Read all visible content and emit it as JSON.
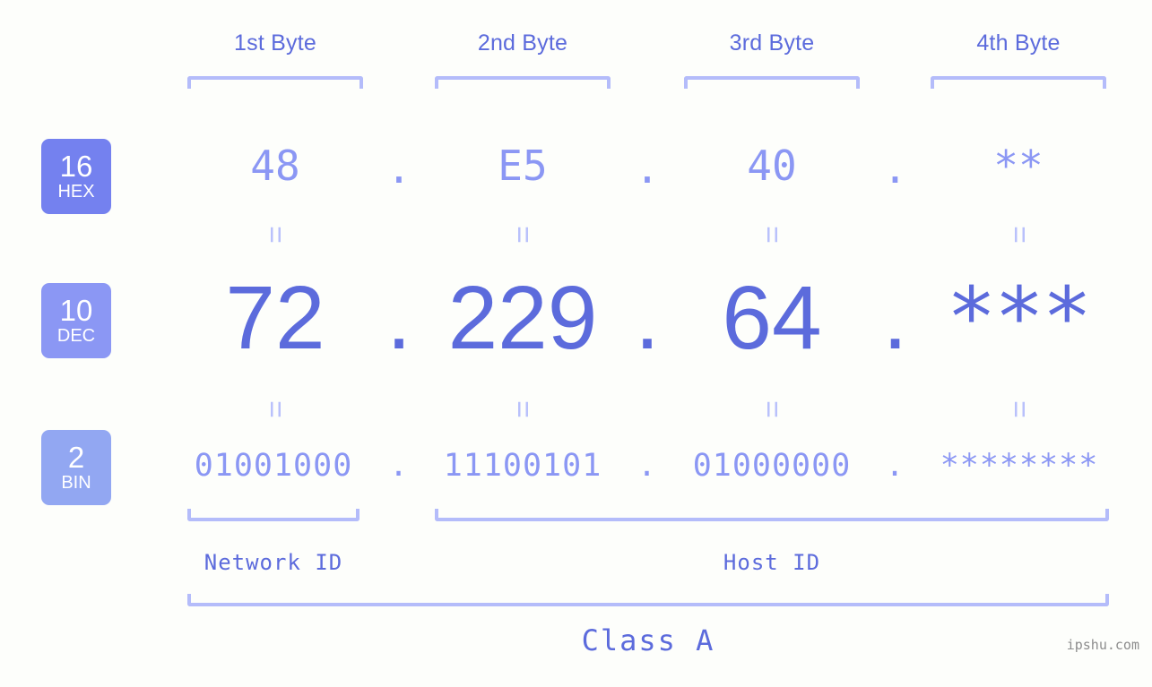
{
  "meta": {
    "background_color": "#fdfefb",
    "accent_dark": "#5c6bdc",
    "accent_mid": "#8b97f4",
    "accent_light": "#b4bcfa",
    "badge_hex_color": "#7481ef",
    "badge_dec_color": "#8b97f4",
    "badge_bin_color": "#92a7f2"
  },
  "byte_headers": [
    {
      "label": "1st Byte"
    },
    {
      "label": "2nd Byte"
    },
    {
      "label": "3rd Byte"
    },
    {
      "label": "4th Byte"
    }
  ],
  "radix_badges": [
    {
      "number": "16",
      "name": "HEX"
    },
    {
      "number": "10",
      "name": "DEC"
    },
    {
      "number": "2",
      "name": "BIN"
    }
  ],
  "rows": {
    "hex": {
      "values": [
        "48",
        "E5",
        "40",
        "**"
      ],
      "separator": "."
    },
    "dec": {
      "values": [
        "72",
        "229",
        "64",
        "***"
      ],
      "separator": "."
    },
    "bin": {
      "values": [
        "01001000",
        "11100101",
        "01000000",
        "********"
      ],
      "separator": "."
    }
  },
  "equality_marker": "=",
  "segments": [
    {
      "label": "Network ID"
    },
    {
      "label": "Host ID"
    }
  ],
  "class_label": "Class A",
  "watermark": "ipshu.com"
}
